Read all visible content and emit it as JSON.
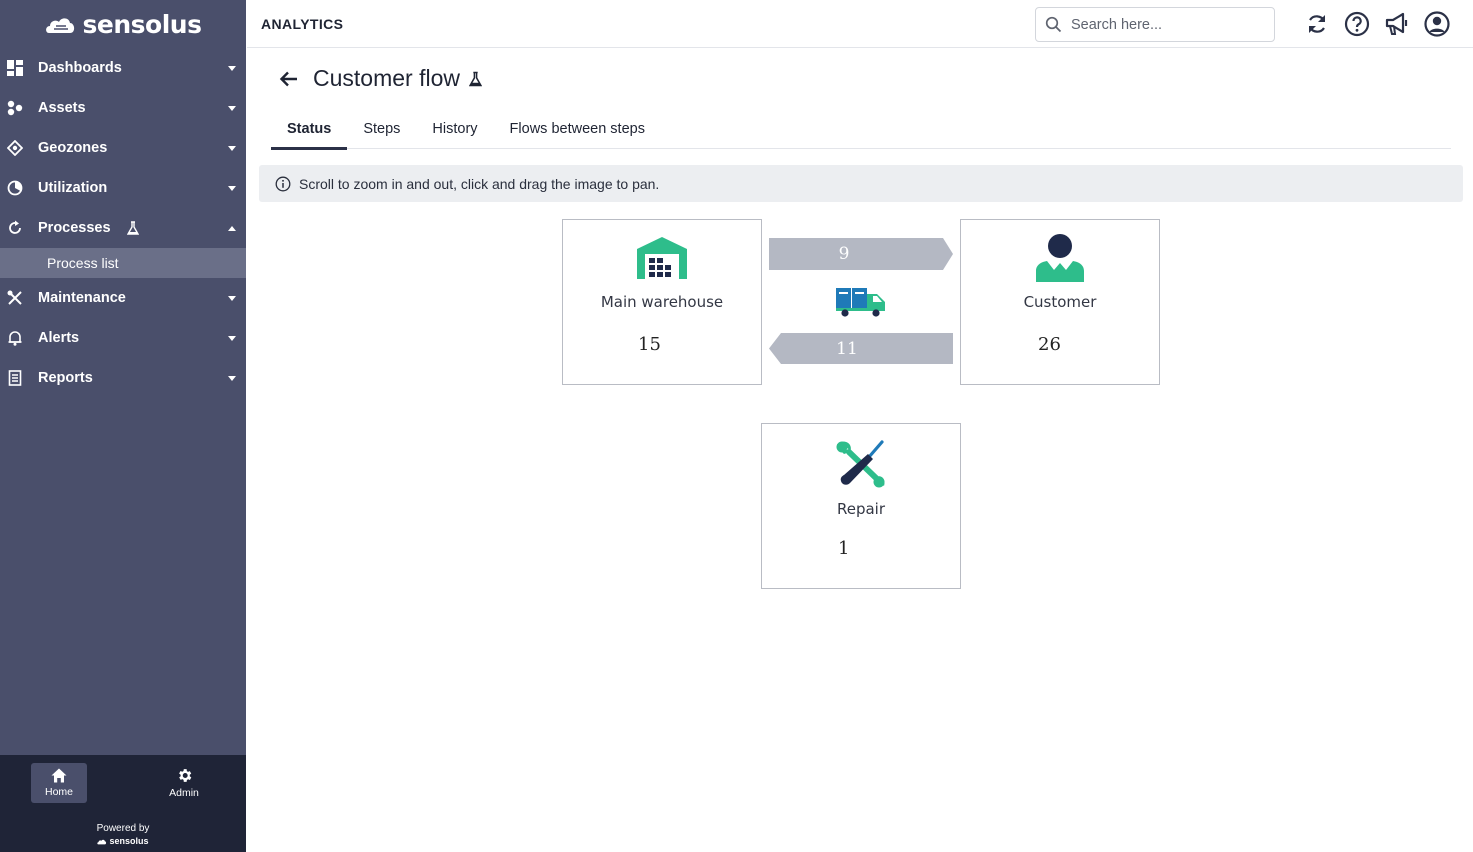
{
  "brand": {
    "name": "sensolus"
  },
  "sidebar": {
    "items": [
      {
        "label": "Dashboards",
        "icon": "dashboard-icon"
      },
      {
        "label": "Assets",
        "icon": "assets-icon"
      },
      {
        "label": "Geozones",
        "icon": "geozone-icon"
      },
      {
        "label": "Utilization",
        "icon": "utilization-icon"
      },
      {
        "label": "Processes",
        "icon": "processes-icon",
        "expanded": true
      },
      {
        "label": "Maintenance",
        "icon": "maintenance-icon"
      },
      {
        "label": "Alerts",
        "icon": "bell-icon"
      },
      {
        "label": "Reports",
        "icon": "reports-icon"
      }
    ],
    "sub_items": [
      {
        "label": "Process list",
        "active": true
      }
    ],
    "bottom": {
      "home_label": "Home",
      "admin_label": "Admin",
      "powered_by": "Powered by",
      "powered_brand": "sensolus"
    }
  },
  "header": {
    "section_title": "ANALYTICS",
    "search_placeholder": "Search here...",
    "icons": [
      "refresh-icon",
      "help-icon",
      "announcement-icon",
      "user-account-icon"
    ]
  },
  "page": {
    "title": "Customer flow",
    "tabs": [
      {
        "label": "Status",
        "active": true
      },
      {
        "label": "Steps"
      },
      {
        "label": "History"
      },
      {
        "label": "Flows between steps"
      }
    ],
    "info": "Scroll to zoom in and out, click and drag the image to pan."
  },
  "flow": {
    "nodes": [
      {
        "name": "Main warehouse",
        "count": "15",
        "icon": "warehouse-icon"
      },
      {
        "name": "Customer",
        "count": "26",
        "icon": "customer-icon"
      },
      {
        "name": "Repair",
        "count": "1",
        "icon": "repair-icon"
      }
    ],
    "transitions": [
      {
        "from": "Main warehouse",
        "to": "Customer",
        "count": "9"
      },
      {
        "from": "Customer",
        "to": "Main warehouse",
        "count": "11"
      }
    ],
    "transport_icon": "truck-icon"
  },
  "colors": {
    "sidebar_bg": "#4a4f6b",
    "sidebar_active": "#6a6f88",
    "sidebar_footer": "#1f2437",
    "accent_green": "#2ebd8b",
    "navy": "#1f2a4a",
    "arrow_gray": "#b4b8c3"
  }
}
